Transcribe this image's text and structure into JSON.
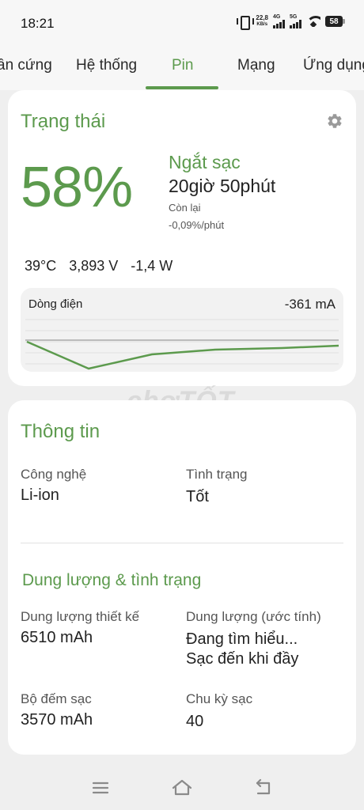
{
  "status_bar": {
    "time": "18:21",
    "net_speed_value": "22,8",
    "net_speed_unit": "KB/s",
    "network_1": "4G",
    "network_2": "5G",
    "battery": "58"
  },
  "tabs": [
    {
      "label": "ần cứng",
      "active": false
    },
    {
      "label": "Hệ thống",
      "active": false
    },
    {
      "label": "Pin",
      "active": true
    },
    {
      "label": "Mạng",
      "active": false
    },
    {
      "label": "Ứng dụng",
      "active": false
    }
  ],
  "status_card": {
    "title": "Trạng thái",
    "percent": "58%",
    "charge_status": "Ngắt sạc",
    "time_left": "20giờ 50phút",
    "remain_label": "Còn lại",
    "rate": "-0,09%/phút",
    "temperature": "39°C",
    "voltage": "3,893 V",
    "power": "-1,4 W",
    "current": {
      "label": "Dòng điện",
      "value": "-361 mA"
    }
  },
  "info_card": {
    "title": "Thông tin",
    "technology_label": "Công nghệ",
    "technology_value": "Li-ion",
    "health_label": "Tình trạng",
    "health_value": "Tốt",
    "capacity_title": "Dung lượng & tình trạng",
    "design_capacity_label": "Dung lượng thiết kế",
    "design_capacity_value": "6510 mAh",
    "estimated_capacity_label": "Dung lượng (ước tính)",
    "estimated_capacity_value_1": "Đang tìm hiểu...",
    "estimated_capacity_value_2": "Sạc đến khi đầy",
    "charge_counter_label": "Bộ đếm sạc",
    "charge_counter_value": "3570 mAh",
    "cycle_label": "Chu kỳ sạc",
    "cycle_value": "40"
  },
  "watermark": "chợTỐT",
  "colors": {
    "accent": "#5c9a4d",
    "background": "#efefef",
    "card": "#ffffff"
  },
  "icons": {
    "settings": "gear-icon",
    "nav_menu": "menu-icon",
    "nav_home": "home-icon",
    "nav_back": "back-icon"
  }
}
